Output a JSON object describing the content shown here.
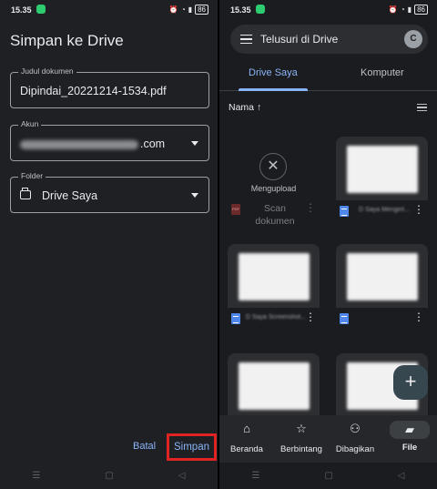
{
  "left": {
    "status_time": "15.35",
    "status_batt": "86",
    "title": "Simpan ke Drive",
    "doc_field": {
      "label": "Judul dokumen",
      "value": "Dipindai_20221214-1534.pdf"
    },
    "account_field": {
      "label": "Akun",
      "value_suffix": ".com"
    },
    "folder_field": {
      "label": "Folder",
      "value": "Drive Saya"
    },
    "cancel_label": "Batal",
    "save_label": "Simpan",
    "highlight_color": "#e02323"
  },
  "right": {
    "status_time": "15.35",
    "status_batt": "86",
    "search_placeholder": "Telusuri di Drive",
    "avatar_initial": "C",
    "tabs": [
      {
        "label": "Drive Saya",
        "active": true
      },
      {
        "label": "Komputer",
        "active": false
      }
    ],
    "sort_label": "Nama",
    "sort_arrow": "↑",
    "uploading_label": "Mengupload",
    "uploading_file": "Scan dokumen",
    "files": [
      {
        "title": "D Saya Mengint..."
      },
      {
        "title": "D Saya Screenshot..."
      },
      {
        "title": ""
      },
      {
        "title": ""
      },
      {
        "title": ""
      }
    ],
    "fab_label": "+",
    "bottom_nav": [
      {
        "label": "Beranda",
        "icon": "home-icon",
        "active": false
      },
      {
        "label": "Berbintang",
        "icon": "star-icon",
        "active": false
      },
      {
        "label": "Dibagikan",
        "icon": "people-icon",
        "active": false
      },
      {
        "label": "File",
        "icon": "folder-icon",
        "active": true
      }
    ],
    "accent_color": "#8ab4f8"
  }
}
